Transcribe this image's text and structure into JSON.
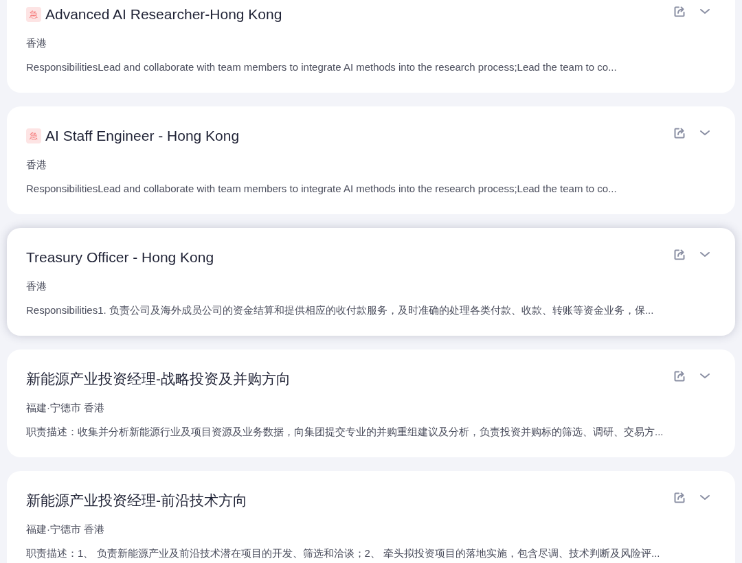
{
  "jobs": [
    {
      "title": "Advanced AI Researcher-Hong Kong",
      "badge": "急",
      "location": "香港",
      "description": "ResponsibilitiesLead and collaborate with team members to integrate AI methods into the research process;Lead the team to co...",
      "hovered": false
    },
    {
      "title": "AI Staff Engineer - Hong Kong",
      "badge": "急",
      "location": "香港",
      "description": "ResponsibilitiesLead and collaborate with team members to integrate AI methods into the research process;Lead the team to co...",
      "hovered": false
    },
    {
      "title": "Treasury Officer - Hong Kong",
      "location": "香港",
      "description": "Responsibilities1. 负责公司及海外成员公司的资金结算和提供相应的收付款服务，及时准确的处理各类付款、收款、转账等资金业务，保...",
      "hovered": true
    },
    {
      "title": "新能源产业投资经理-战略投资及并购方向",
      "location": "福建·宁德市 香港",
      "description": "职责描述：收集并分析新能源行业及项目资源及业务数据，向集团提交专业的并购重组建议及分析，负责投资并购标的筛选、调研、交易方...",
      "hovered": false
    },
    {
      "title": "新能源产业投资经理-前沿技术方向",
      "location": "福建·宁德市 香港",
      "description": "职责描述：1、 负责新能源产业及前沿技术潜在项目的开发、筛选和洽谈；2、 牵头拟投资项目的落地实施，包含尽调、技术判断及风险评...",
      "hovered": false
    }
  ]
}
